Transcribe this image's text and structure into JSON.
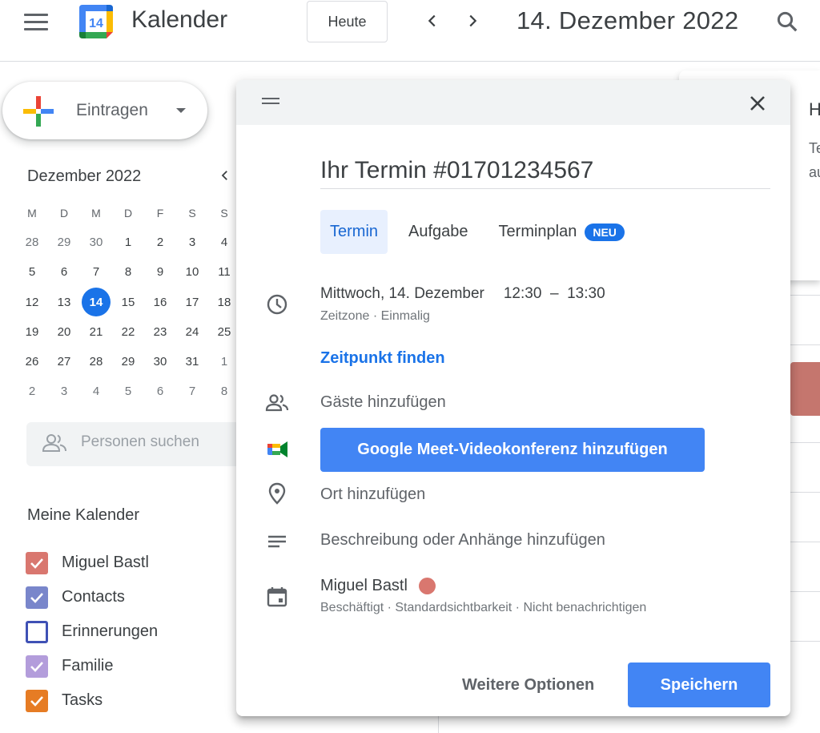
{
  "header": {
    "app_logo_day": "14",
    "app_title": "Kalender",
    "today_label": "Heute",
    "date_title": "14. Dezember 2022"
  },
  "sidebar": {
    "create_label": "Eintragen",
    "mini_calendar": {
      "title": "Dezember 2022",
      "weekdays": [
        "M",
        "D",
        "M",
        "D",
        "F",
        "S",
        "S"
      ],
      "weeks": [
        [
          "28",
          "29",
          "30",
          "1",
          "2",
          "3",
          "4"
        ],
        [
          "5",
          "6",
          "7",
          "8",
          "9",
          "10",
          "11"
        ],
        [
          "12",
          "13",
          "14",
          "15",
          "16",
          "17",
          "18"
        ],
        [
          "19",
          "20",
          "21",
          "22",
          "23",
          "24",
          "25"
        ],
        [
          "26",
          "27",
          "28",
          "29",
          "30",
          "31",
          "1"
        ],
        [
          "2",
          "3",
          "4",
          "5",
          "6",
          "7",
          "8"
        ]
      ],
      "today": "14"
    },
    "people_search_placeholder": "Personen suchen",
    "my_calendars_title": "Meine Kalender",
    "calendars": [
      {
        "label": "Miguel Bastl",
        "color": "#d9776f",
        "checked": true
      },
      {
        "label": "Contacts",
        "color": "#7986cb",
        "checked": true
      },
      {
        "label": "Erinnerungen",
        "color": "#3f51b5",
        "checked": false
      },
      {
        "label": "Familie",
        "color": "#b39ddb",
        "checked": true
      },
      {
        "label": "Tasks",
        "color": "#e67c24",
        "checked": true
      }
    ]
  },
  "background_panel": {
    "letter": "H",
    "line1": "Te",
    "line2": "au"
  },
  "dialog": {
    "title_value": "Ihr Termin #01701234567",
    "tabs": {
      "event": "Termin",
      "task": "Aufgabe",
      "appointment": "Terminplan",
      "new_badge": "NEU"
    },
    "when": {
      "date": "Mittwoch, 14. Dezember",
      "start": "12:30",
      "separator": "–",
      "end": "13:30",
      "sub": "Zeitzone · Einmalig"
    },
    "find_time": "Zeitpunkt finden",
    "add_guests": "Gäste hinzufügen",
    "meet_button": "Google Meet-Videokonferenz hinzufügen",
    "add_location": "Ort hinzufügen",
    "add_description": "Beschreibung oder Anhänge hinzufügen",
    "owner": {
      "name": "Miguel Bastl",
      "color": "#d9776f",
      "sub": "Beschäftigt · Standardsichtbarkeit · Nicht benachrichtigen"
    },
    "more_options": "Weitere Optionen",
    "save": "Speichern"
  },
  "colors": {
    "accent": "#1a73e8",
    "button_blue": "#4285f4",
    "tab_active_bg": "#e8f0fe"
  }
}
